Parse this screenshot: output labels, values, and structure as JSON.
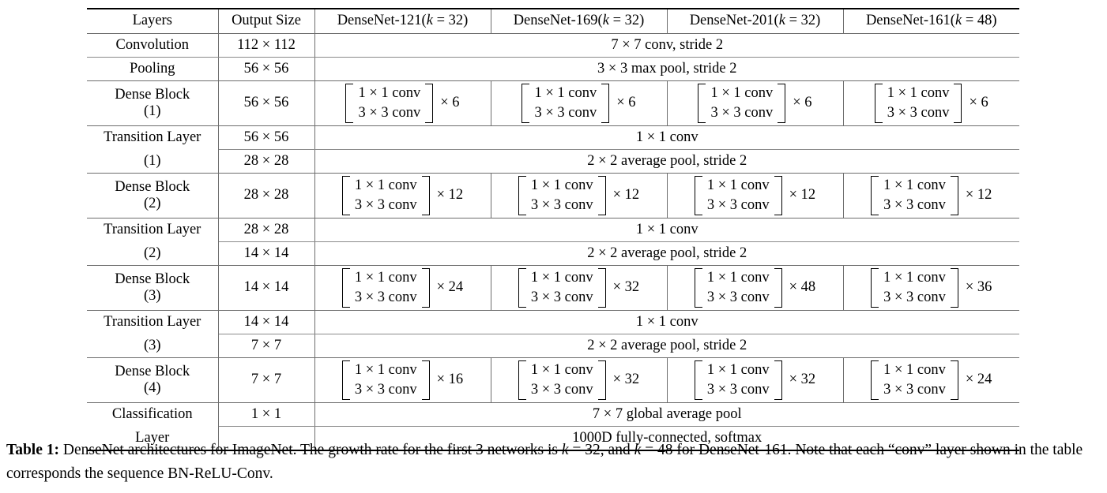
{
  "table": {
    "headers": {
      "layers": "Layers",
      "output_size": "Output Size",
      "nets": [
        {
          "name": "DenseNet-121",
          "k_prefix": "(",
          "k_label": "k",
          "k_eq": " = 32)"
        },
        {
          "name": "DenseNet-169",
          "k_prefix": "(",
          "k_label": "k",
          "k_eq": " = 32)"
        },
        {
          "name": "DenseNet-201",
          "k_prefix": "(",
          "k_label": "k",
          "k_eq": " = 32)"
        },
        {
          "name": "DenseNet-161",
          "k_prefix": "(",
          "k_label": "k",
          "k_eq": " = 48)"
        }
      ]
    },
    "rows": {
      "convolution": {
        "layer": "Convolution",
        "output_size": "112 × 112",
        "spanned": "7 × 7 conv, stride 2"
      },
      "pooling": {
        "layer": "Pooling",
        "output_size": "56 × 56",
        "spanned": "3 × 3 max pool, stride 2"
      },
      "dense_block_1": {
        "layer": "Dense Block",
        "layer_index": "(1)",
        "output_size": "56 × 56",
        "conv_a": "1 × 1 conv",
        "conv_b": "3 × 3 conv",
        "multipliers": [
          "× 6",
          "× 6",
          "× 6",
          "× 6"
        ]
      },
      "transition_1": {
        "layer": "Transition Layer",
        "layer_index": "(1)",
        "output_size_a": "56 × 56",
        "output_size_b": "28 × 28",
        "spanned_a": "1 × 1 conv",
        "spanned_b": "2 × 2 average pool, stride 2"
      },
      "dense_block_2": {
        "layer": "Dense Block",
        "layer_index": "(2)",
        "output_size": "28 × 28",
        "conv_a": "1 × 1 conv",
        "conv_b": "3 × 3 conv",
        "multipliers": [
          "× 12",
          "× 12",
          "× 12",
          "× 12"
        ]
      },
      "transition_2": {
        "layer": "Transition Layer",
        "layer_index": "(2)",
        "output_size_a": "28 × 28",
        "output_size_b": "14 × 14",
        "spanned_a": "1 × 1 conv",
        "spanned_b": "2 × 2 average pool, stride 2"
      },
      "dense_block_3": {
        "layer": "Dense Block",
        "layer_index": "(3)",
        "output_size": "14 × 14",
        "conv_a": "1 × 1 conv",
        "conv_b": "3 × 3 conv",
        "multipliers": [
          "× 24",
          "× 32",
          "× 48",
          "× 36"
        ]
      },
      "transition_3": {
        "layer": "Transition Layer",
        "layer_index": "(3)",
        "output_size_a": "14 × 14",
        "output_size_b": "7 × 7",
        "spanned_a": "1 × 1 conv",
        "spanned_b": "2 × 2 average pool, stride 2"
      },
      "dense_block_4": {
        "layer": "Dense Block",
        "layer_index": "(4)",
        "output_size": "7 × 7",
        "conv_a": "1 × 1 conv",
        "conv_b": "3 × 3 conv",
        "multipliers": [
          "× 16",
          "× 32",
          "× 32",
          "× 24"
        ]
      },
      "classification": {
        "layer_a": "Classification",
        "layer_b": "Layer",
        "output_size_a": "1 × 1",
        "output_size_b": "",
        "spanned_a": "7 × 7 global average pool",
        "spanned_b": "1000D fully-connected, softmax"
      }
    }
  },
  "caption": {
    "label": "Table 1:",
    "text_1": " DenseNet architectures for ImageNet. The growth rate for the first 3 networks is ",
    "k_1": "k",
    "text_2": " = 32, and ",
    "k_2": "k",
    "text_3": " = 48 for DenseNet-161. Note that each “conv” layer shown in the table corresponds the sequence BN-ReLU-Conv."
  }
}
